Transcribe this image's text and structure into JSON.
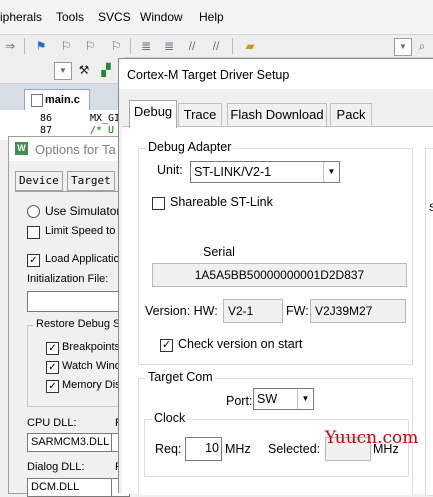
{
  "ide": {
    "menu": [
      "ipherals",
      "Tools",
      "SVCS",
      "Window",
      "Help"
    ],
    "editor": {
      "tab_label": "main.c",
      "lines": [
        {
          "no": "86",
          "code": "MX_GI"
        },
        {
          "no": "87",
          "code": "/* U"
        }
      ]
    }
  },
  "options_dialog": {
    "title": "Options for Ta",
    "tabs": [
      "Device",
      "Target",
      "O"
    ],
    "use_simulator": "Use Simulator",
    "limit_speed": "Limit Speed to R",
    "load_application": "Load Applicatio",
    "init_file_label": "Initialization File:",
    "restore_group": "Restore Debug S",
    "restore_items": [
      "Breakpoints",
      "Watch Windo",
      "Memory Displ"
    ],
    "cpu_dll_label": "CPU DLL:",
    "cpu_dll_value": "SARMCM3.DLL",
    "p_label": "P",
    "dialog_dll_label": "Dialog DLL:",
    "dialog_dll_value": "DCM.DLL"
  },
  "driver_setup": {
    "title": "Cortex-M Target Driver Setup",
    "tabs": [
      "Debug",
      "Trace",
      "Flash Download",
      "Pack"
    ],
    "active_tab": "Debug",
    "debug_adapter": {
      "group_title": "Debug Adapter",
      "unit_label": "Unit:",
      "unit_value": "ST-LINK/V2-1",
      "shareable_label": "Shareable ST-Link",
      "serial_label": "Serial",
      "serial_value": "1A5A5BB50000000001D2D837",
      "version_label": "Version: HW:",
      "hw_value": "V2-1",
      "fw_label": "FW:",
      "fw_value": "V2J39M27",
      "check_version_label": "Check version on start"
    },
    "target_com": {
      "group_title": "Target Com",
      "port_label": "Port:",
      "port_value": "SW",
      "clock": {
        "group_title": "Clock",
        "req_label": "Req:",
        "req_value": "10",
        "req_unit": "MHz",
        "selected_label": "Selected:",
        "selected_unit": "MHz"
      }
    },
    "side_letter": "S"
  },
  "watermark": "Yuucn.com"
}
